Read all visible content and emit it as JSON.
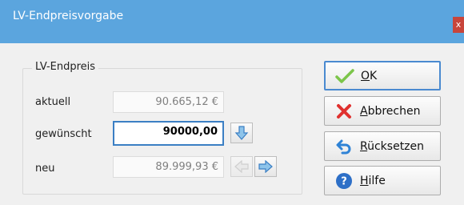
{
  "window": {
    "title": "LV-Endpreisvorgabe",
    "close_glyph": "x"
  },
  "group": {
    "label": "LV-Endpreis"
  },
  "rows": [
    {
      "label": "aktuell",
      "value": "90.665,12 €"
    },
    {
      "label": "gewünscht",
      "value": "90000,00"
    },
    {
      "label": "neu",
      "value": "89.999,93 €"
    }
  ],
  "buttons": [
    {
      "mnemonic": "O",
      "rest": "K",
      "icon": "checkmark-icon"
    },
    {
      "mnemonic": "A",
      "rest": "bbrechen",
      "icon": "cancel-x-icon"
    },
    {
      "mnemonic": "R",
      "rest": "ücksetzen",
      "icon": "undo-arrow-icon"
    },
    {
      "mnemonic": "H",
      "rest": "ilfe",
      "icon": "help-icon"
    }
  ],
  "colors": {
    "titlebar": "#5ba5de",
    "close": "#c8453b",
    "accent_border": "#4a8ad0"
  }
}
